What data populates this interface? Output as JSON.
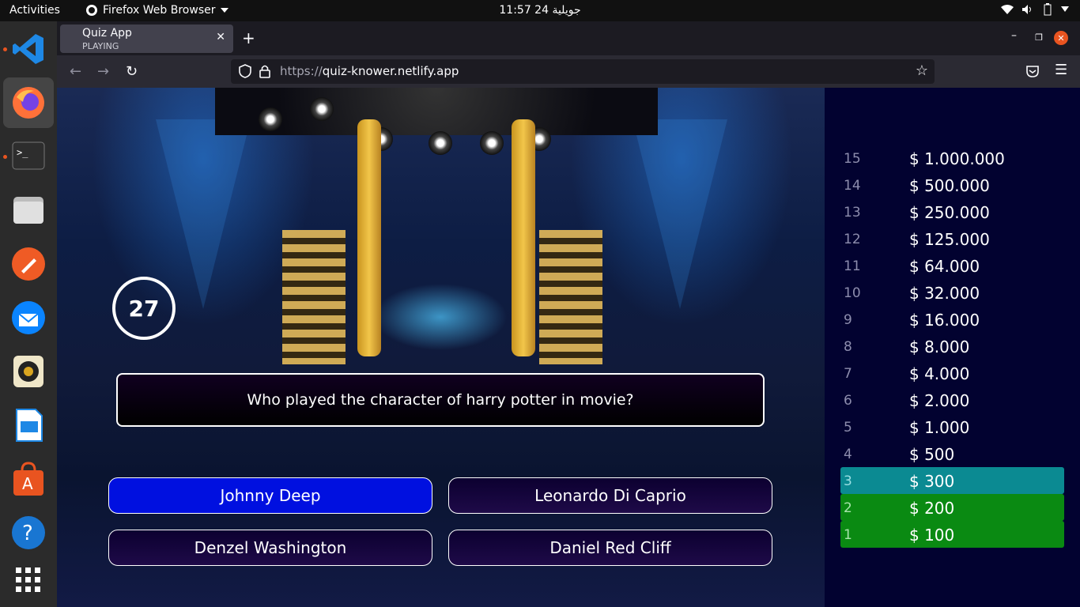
{
  "system": {
    "activities": "Activities",
    "app_menu": "Firefox Web Browser",
    "clock": "11:57  24 جويلية"
  },
  "dock": [
    {
      "name": "vscode",
      "color": "#1e88e5"
    },
    {
      "name": "firefox",
      "color": "#ff7139"
    },
    {
      "name": "terminal",
      "color": "#2d2d2d"
    },
    {
      "name": "files",
      "color": "#9e9e9e"
    },
    {
      "name": "postman",
      "color": "#ef5b25"
    },
    {
      "name": "thunderbird",
      "color": "#0a84ff"
    },
    {
      "name": "rhythmbox",
      "color": "#e0c068"
    },
    {
      "name": "writer",
      "color": "#2196f3"
    },
    {
      "name": "software",
      "color": "#e95420"
    },
    {
      "name": "help",
      "color": "#1976d2"
    }
  ],
  "browser": {
    "tab_title": "Quiz App",
    "tab_subtitle": "PLAYING",
    "url_proto": "https://",
    "url_host": "quiz-knower.netlify.app"
  },
  "quiz": {
    "timer": "27",
    "question": "Who played the character of harry potter in movie?",
    "answers": [
      "Johnny Deep",
      "Leonardo Di Caprio",
      "Denzel Washington",
      "Daniel Red Cliff"
    ],
    "selected_answer_index": 0
  },
  "pyramid": [
    {
      "num": "15",
      "amount": "$ 1.000.000",
      "state": "pending"
    },
    {
      "num": "14",
      "amount": "$ 500.000",
      "state": "pending"
    },
    {
      "num": "13",
      "amount": "$ 250.000",
      "state": "pending"
    },
    {
      "num": "12",
      "amount": "$ 125.000",
      "state": "pending"
    },
    {
      "num": "11",
      "amount": "$ 64.000",
      "state": "pending"
    },
    {
      "num": "10",
      "amount": "$ 32.000",
      "state": "pending"
    },
    {
      "num": "9",
      "amount": "$ 16.000",
      "state": "pending"
    },
    {
      "num": "8",
      "amount": "$ 8.000",
      "state": "pending"
    },
    {
      "num": "7",
      "amount": "$ 4.000",
      "state": "pending"
    },
    {
      "num": "6",
      "amount": "$ 2.000",
      "state": "pending"
    },
    {
      "num": "5",
      "amount": "$ 1.000",
      "state": "pending"
    },
    {
      "num": "4",
      "amount": "$ 500",
      "state": "pending"
    },
    {
      "num": "3",
      "amount": "$ 300",
      "state": "active"
    },
    {
      "num": "2",
      "amount": "$ 200",
      "state": "done"
    },
    {
      "num": "1",
      "amount": "$ 100",
      "state": "done"
    }
  ],
  "colors": {
    "active_level": "#0b8a92",
    "completed_level": "#0a8a12",
    "selected_answer": "#0010e0"
  }
}
